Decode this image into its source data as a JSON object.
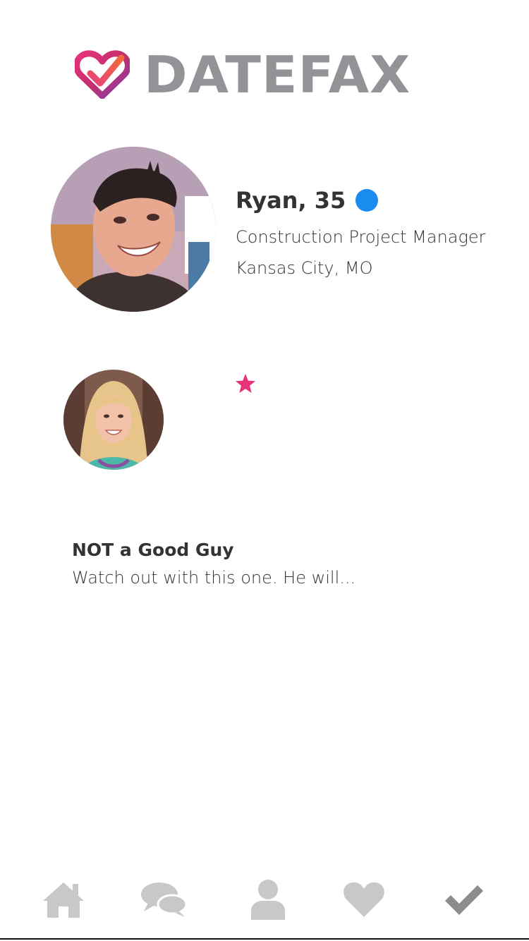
{
  "app": {
    "logo_text": "DATEFAX",
    "brand_colors": {
      "heart_left": "#e8337a",
      "heart_right": "#7b3fb5",
      "text": "#929396"
    }
  },
  "profile": {
    "name_age": "Ryan, 35",
    "verified": true,
    "verified_color": "#1a8cf0",
    "occupation": "Construction Project Manager",
    "location": "Kansas City, MO"
  },
  "review": {
    "rating_icon": "star-icon",
    "rating_color": "#e8337a",
    "title": "NOT a Good Guy",
    "snippet": "Watch out with this one. He will..."
  },
  "nav": {
    "items": [
      {
        "icon": "home-icon",
        "active": false
      },
      {
        "icon": "chat-bubbles-icon",
        "active": false
      },
      {
        "icon": "user-icon",
        "active": false
      },
      {
        "icon": "heart-icon",
        "active": false
      },
      {
        "icon": "checkmark-icon",
        "active": true
      }
    ]
  }
}
